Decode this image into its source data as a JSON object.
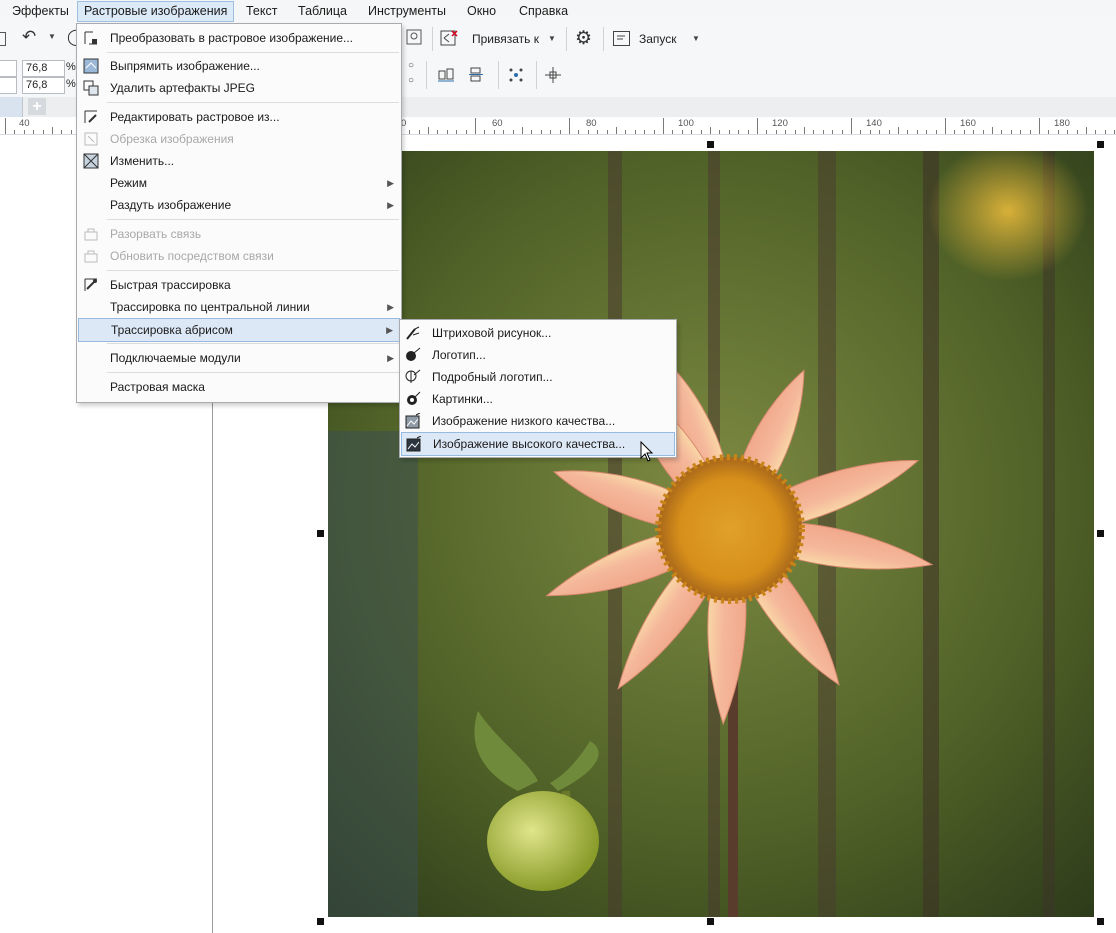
{
  "menubar": {
    "items": [
      {
        "label": "Эффекты"
      },
      {
        "label": "Растровые изображения"
      },
      {
        "label": "Текст"
      },
      {
        "label": "Таблица"
      },
      {
        "label": "Инструменты"
      },
      {
        "label": "Окно"
      },
      {
        "label": "Справка"
      }
    ]
  },
  "toolbar": {
    "snap_label": "Привязать к",
    "launch_label": "Запуск",
    "width_pct": "76,8",
    "height_pct": "76,8",
    "pct_unit": "%"
  },
  "ruler": {
    "labels": [
      "40",
      "0",
      "60",
      "80",
      "100",
      "120",
      "140",
      "160",
      "180"
    ]
  },
  "bitmap_menu": {
    "items": [
      {
        "label": "Преобразовать в растровое изображение...",
        "icon": "convert-bitmap-icon"
      },
      {
        "label": "Выпрямить изображение...",
        "icon": "straighten-icon"
      },
      {
        "label": "Удалить артефакты JPEG",
        "icon": "jpeg-artifacts-icon"
      },
      {
        "label": "Редактировать растровое из...",
        "icon": "edit-bitmap-icon"
      },
      {
        "label": "Обрезка изображения",
        "icon": "crop-bitmap-icon"
      },
      {
        "label": "Изменить...",
        "icon": "resample-icon"
      },
      {
        "label": "Режим"
      },
      {
        "label": "Раздуть изображение"
      },
      {
        "label": "Разорвать связь",
        "icon": "break-link-icon"
      },
      {
        "label": "Обновить посредством связи",
        "icon": "update-link-icon"
      },
      {
        "label": "Быстрая трассировка",
        "icon": "quick-trace-icon"
      },
      {
        "label": "Трассировка по центральной линии"
      },
      {
        "label": "Трассировка абрисом"
      },
      {
        "label": "Подключаемые модули"
      },
      {
        "label": "Растровая маска"
      }
    ]
  },
  "outline_trace_menu": {
    "items": [
      {
        "label": "Штриховой рисунок...",
        "icon": "line-art-icon"
      },
      {
        "label": "Логотип...",
        "icon": "logo-icon"
      },
      {
        "label": "Подробный логотип...",
        "icon": "detailed-logo-icon"
      },
      {
        "label": "Картинки...",
        "icon": "clipart-icon"
      },
      {
        "label": "Изображение низкого качества...",
        "icon": "low-quality-image-icon"
      },
      {
        "label": "Изображение высокого качества...",
        "icon": "high-quality-image-icon"
      }
    ]
  }
}
